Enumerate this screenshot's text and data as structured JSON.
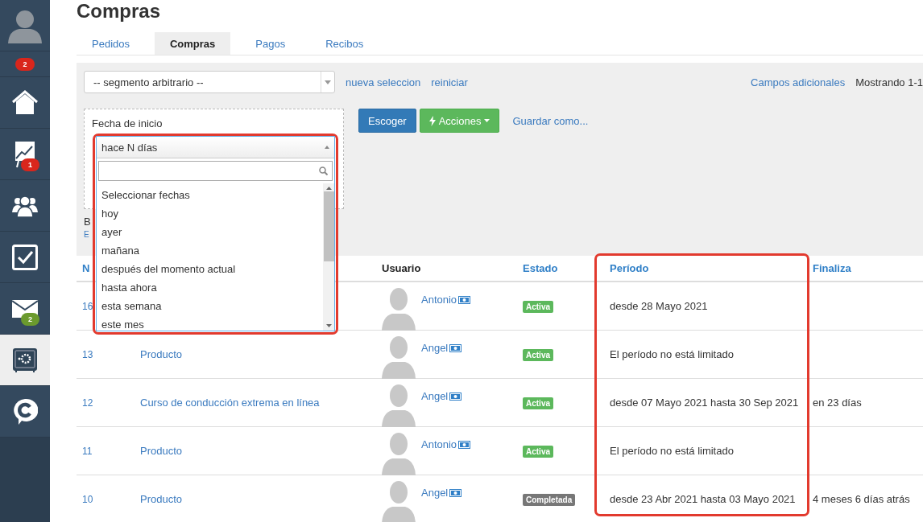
{
  "sidebar": {
    "items": [
      {
        "kind": "avatar",
        "selected": false
      },
      {
        "kind": "counter",
        "badge": "2",
        "color": "#d9261c",
        "selected": false
      },
      {
        "kind": "home",
        "selected": false
      },
      {
        "kind": "chart",
        "badge": "1",
        "color": "#d9261c",
        "selected": false
      },
      {
        "kind": "users",
        "selected": false
      },
      {
        "kind": "tasks",
        "selected": false
      },
      {
        "kind": "mail",
        "badge": "2",
        "color": "#6b9a2e",
        "selected": false
      },
      {
        "kind": "safe",
        "selected": true
      },
      {
        "kind": "chat",
        "selected": false
      }
    ]
  },
  "page": {
    "title": "Compras"
  },
  "tabs": [
    {
      "label": "Pedidos",
      "selected": false
    },
    {
      "label": "Compras",
      "selected": true
    },
    {
      "label": "Pagos",
      "selected": false
    },
    {
      "label": "Recibos",
      "selected": false
    }
  ],
  "filters": {
    "segment": {
      "value": "-- segmento arbitrario --"
    },
    "links": [
      "nueva seleccion",
      "reiniciar"
    ],
    "extra_fields": "Campos adicionales",
    "showing": "Mostrando 1-1",
    "date_filter": {
      "label": "Fecha de inicio"
    },
    "fragment_label": "B",
    "fragment_link": "E",
    "buttons": [
      {
        "label": "Escoger",
        "kind": "primary"
      },
      {
        "label": "Acciones",
        "kind": "actions"
      },
      {
        "label": "Guardar como...",
        "kind": "link"
      }
    ]
  },
  "dropdown": {
    "highlighted": true,
    "value": "hace N días",
    "options": [
      "Seleccionar fechas",
      "hoy",
      "ayer",
      "mañana",
      "después del momento actual",
      "hasta ahora",
      "esta semana",
      "este mes"
    ]
  },
  "table": {
    "period_highlighted": true,
    "columns": [
      "N",
      "",
      "Usuario",
      "Estado",
      "Período",
      "Finaliza"
    ],
    "rows": [
      {
        "id": "16",
        "user": "Antonio",
        "status": {
          "label": "Activa",
          "kind": "active"
        },
        "period": "desde 28 Mayo 2021"
      },
      {
        "id": "13",
        "product": "Producto",
        "user": "Angel",
        "status": {
          "label": "Activa",
          "kind": "active"
        },
        "period": "El período no está limitado"
      },
      {
        "id": "12",
        "product": "Curso de conducción extrema en línea",
        "user": "Angel",
        "status": {
          "label": "Activa",
          "kind": "active"
        },
        "period": "desde 07 Mayo 2021 hasta 30 Sep 2021",
        "ends": "en 23 días"
      },
      {
        "id": "11",
        "product": "Producto",
        "user": "Antonio",
        "status": {
          "label": "Activa",
          "kind": "active"
        },
        "period": "El período no está limitado"
      },
      {
        "id": "10",
        "product": "Producto",
        "user": "Angel",
        "status": {
          "label": "Completada",
          "kind": "completed"
        },
        "period": "desde 23 Abr 2021 hasta 03 Mayo 2021",
        "ends": "4 meses 6 días atrás"
      }
    ]
  }
}
